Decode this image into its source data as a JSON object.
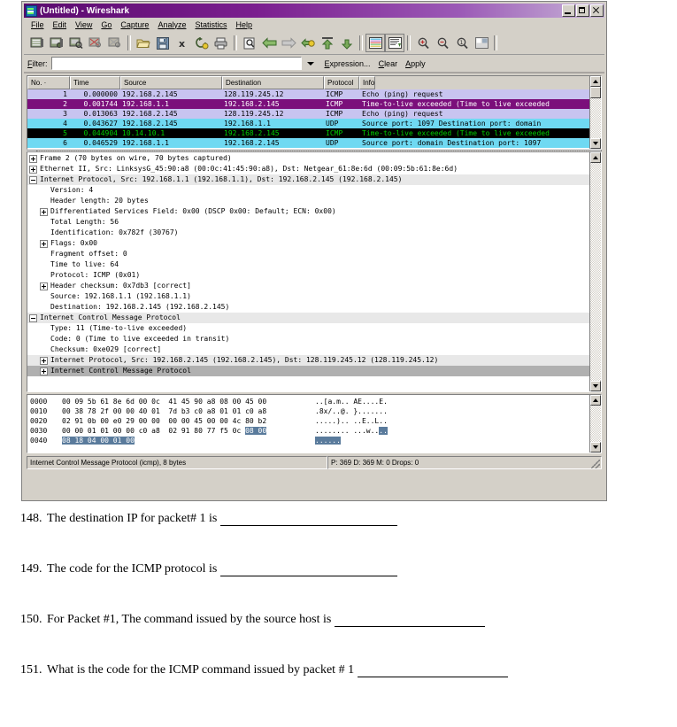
{
  "window": {
    "title": "(Untitled) - Wireshark",
    "app_icon": "wireshark-icon",
    "buttons": {
      "minimize": "minimize-button",
      "maximize": "maximize-button",
      "close": "close-button"
    }
  },
  "menubar": {
    "items": [
      {
        "label": "File",
        "accel": "F"
      },
      {
        "label": "Edit",
        "accel": "E"
      },
      {
        "label": "View",
        "accel": "V"
      },
      {
        "label": "Go",
        "accel": "G"
      },
      {
        "label": "Capture",
        "accel": "C"
      },
      {
        "label": "Analyze",
        "accel": "A"
      },
      {
        "label": "Statistics",
        "accel": "S"
      },
      {
        "label": "Help",
        "accel": "H"
      }
    ]
  },
  "toolbar": {
    "icons": [
      "list-interfaces-icon",
      "capture-options-icon",
      "start-capture-icon",
      "stop-capture-icon",
      "restart-capture-icon",
      "open-file-icon",
      "save-file-icon",
      "close-file-icon",
      "reload-file-icon",
      "print-icon",
      "find-packet-icon",
      "go-back-icon",
      "go-forward-icon",
      "go-to-packet-icon",
      "go-first-packet-icon",
      "go-last-packet-icon",
      "colorize-icon",
      "auto-scroll-icon",
      "zoom-in-icon",
      "zoom-out-icon",
      "zoom-100-icon",
      "resize-columns-icon"
    ]
  },
  "filter": {
    "label": "Filter:",
    "value": "",
    "placeholder": "",
    "dropdown_icon": "chevron-down-icon",
    "expression_label": "Expression...",
    "clear_label": "Clear",
    "apply_label": "Apply"
  },
  "packet_list": {
    "columns": [
      "No. ·",
      "Time",
      "Source",
      "Destination",
      "Protocol",
      "Info"
    ],
    "rows": [
      {
        "no": "1",
        "time": "0.000000",
        "source": "192.168.2.145",
        "destination": "128.119.245.12",
        "protocol": "ICMP",
        "info": "Echo (ping) request",
        "bg": "#c8c4f0",
        "fg": "#000000"
      },
      {
        "no": "2",
        "time": "0.001744",
        "source": "192.168.1.1",
        "destination": "192.168.2.145",
        "protocol": "ICMP",
        "info": "Time-to-live exceeded (Time to live exceeded",
        "bg": "#7b0f7b",
        "fg": "#ffffff"
      },
      {
        "no": "3",
        "time": "0.013063",
        "source": "192.168.2.145",
        "destination": "128.119.245.12",
        "protocol": "ICMP",
        "info": "Echo (ping) request",
        "bg": "#c8c4f0",
        "fg": "#000000"
      },
      {
        "no": "4",
        "time": "0.043627",
        "source": "192.168.2.145",
        "destination": "192.168.1.1",
        "protocol": "UDP",
        "info": "Source port: 1097  Destination port: domain",
        "bg": "#6fd9f2",
        "fg": "#000000"
      },
      {
        "no": "5",
        "time": "0.044904",
        "source": "10.14.10.1",
        "destination": "192.168.2.145",
        "protocol": "ICMP",
        "info": "Time-to-live exceeded (Time to live exceeded",
        "bg": "#000000",
        "fg": "#00ce00"
      },
      {
        "no": "6",
        "time": "0.046529",
        "source": "192.168.1.1",
        "destination": "192.168.2.145",
        "protocol": "UDP",
        "info": "Source port: domain  Destination port: 1097",
        "bg": "#6fd9f2",
        "fg": "#000000"
      }
    ]
  },
  "packet_detail": {
    "rows": [
      {
        "text": "Frame 2 (70 bytes on wire, 70 bytes captured)",
        "expander": "plus",
        "indent": 1,
        "state": ""
      },
      {
        "text": "Ethernet II, Src: LinksysG_45:90:a8 (00:0c:41:45:90:a8), Dst: Netgear_61:8e:6d (00:09:5b:61:8e:6d)",
        "expander": "plus",
        "indent": 1,
        "state": ""
      },
      {
        "text": "Internet Protocol, Src: 192.168.1.1 (192.168.1.1), Dst: 192.168.2.145 (192.168.2.145)",
        "expander": "minus",
        "indent": 1,
        "state": "sel-light"
      },
      {
        "text": "Version: 4",
        "expander": "none",
        "indent": 2,
        "state": ""
      },
      {
        "text": "Header length: 20 bytes",
        "expander": "none",
        "indent": 2,
        "state": ""
      },
      {
        "text": "Differentiated Services Field: 0x00 (DSCP 0x00: Default; ECN: 0x00)",
        "expander": "plus",
        "indent": 2,
        "state": ""
      },
      {
        "text": "Total Length: 56",
        "expander": "none",
        "indent": 2,
        "state": ""
      },
      {
        "text": "Identification: 0x782f (30767)",
        "expander": "none",
        "indent": 2,
        "state": ""
      },
      {
        "text": "Flags: 0x00",
        "expander": "plus",
        "indent": 2,
        "state": ""
      },
      {
        "text": "Fragment offset: 0",
        "expander": "none",
        "indent": 2,
        "state": ""
      },
      {
        "text": "Time to live: 64",
        "expander": "none",
        "indent": 2,
        "state": ""
      },
      {
        "text": "Protocol: ICMP (0x01)",
        "expander": "none",
        "indent": 2,
        "state": ""
      },
      {
        "text": "Header checksum: 0x7db3 [correct]",
        "expander": "plus",
        "indent": 2,
        "state": ""
      },
      {
        "text": "Source: 192.168.1.1 (192.168.1.1)",
        "expander": "none",
        "indent": 2,
        "state": ""
      },
      {
        "text": "Destination: 192.168.2.145 (192.168.2.145)",
        "expander": "none",
        "indent": 2,
        "state": ""
      },
      {
        "text": "Internet Control Message Protocol",
        "expander": "minus",
        "indent": 1,
        "state": "sel-light"
      },
      {
        "text": "Type: 11 (Time-to-live exceeded)",
        "expander": "none",
        "indent": 2,
        "state": ""
      },
      {
        "text": "Code: 0 (Time to live exceeded in transit)",
        "expander": "none",
        "indent": 2,
        "state": ""
      },
      {
        "text": "Checksum: 0xe029 [correct]",
        "expander": "none",
        "indent": 2,
        "state": ""
      },
      {
        "text": "Internet Protocol, Src: 192.168.2.145 (192.168.2.145), Dst: 128.119.245.12 (128.119.245.12)",
        "expander": "plus",
        "indent": 2,
        "state": "sel-light"
      },
      {
        "text": "Internet Control Message Protocol",
        "expander": "plus",
        "indent": 2,
        "state": "sel-dark"
      }
    ]
  },
  "hex_dump": {
    "rows": [
      {
        "offset": "0000",
        "bytes": "00 09 5b 61 8e 6d 00 0c  41 45 90 a8 08 00 45 00",
        "ascii": "..[a.m.. AE....E."
      },
      {
        "offset": "0010",
        "bytes": "00 38 78 2f 00 00 40 01  7d b3 c0 a8 01 01 c0 a8",
        "ascii": ".8x/..@. }......."
      },
      {
        "offset": "0020",
        "bytes": "02 91 0b 00 e0 29 00 00  00 00 45 00 00 4c 80 b2",
        "ascii": ".....).. ..E..L.."
      },
      {
        "offset": "0030",
        "bytes": "00 00 01 01 00 00 c0 a8  02 91 80 77 f5 0c ",
        "bytes_highlight": "08 00",
        "ascii": "........ ...w..",
        "ascii_highlight": ".."
      },
      {
        "offset": "0040",
        "bytes": "",
        "bytes_highlight": "08 18 04 00 01 00",
        "ascii": "",
        "ascii_highlight": "......"
      }
    ]
  },
  "statusbar": {
    "left": "Internet Control Message Protocol (icmp), 8 bytes",
    "right": "P: 369 D: 369 M: 0 Drops: 0"
  },
  "questions": [
    {
      "number": "148.",
      "text": "The  destination IP for packet# 1 is",
      "blank_width": 200
    },
    {
      "number": "149.",
      "text": "The code for the ICMP protocol is",
      "blank_width": 200
    },
    {
      "number": "150.",
      "text": "For Packet #1, The command issued by the source host is",
      "blank_width": 170
    },
    {
      "number": "151.",
      "text": "What is the code for the ICMP command issued by packet # 1",
      "blank_width": 170
    }
  ]
}
